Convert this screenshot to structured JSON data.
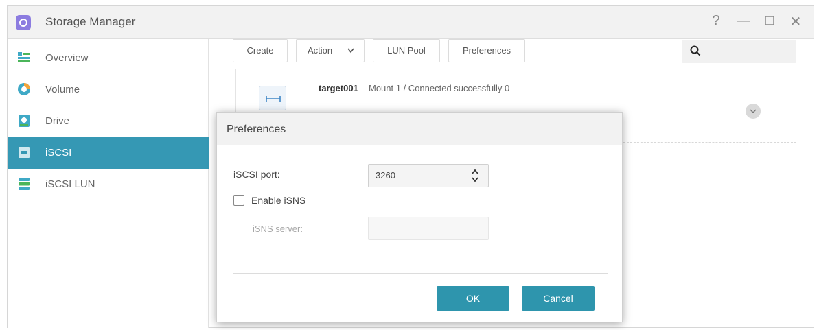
{
  "window": {
    "title": "Storage Manager",
    "controls": [
      "?",
      "—",
      "□",
      "✕"
    ]
  },
  "sidebar": {
    "items": [
      {
        "label": "Overview",
        "icon": "overview-icon"
      },
      {
        "label": "Volume",
        "icon": "volume-icon"
      },
      {
        "label": "Drive",
        "icon": "drive-icon"
      },
      {
        "label": "iSCSI",
        "icon": "iscsi-icon",
        "active": true
      },
      {
        "label": "iSCSI LUN",
        "icon": "iscsi-lun-icon"
      }
    ]
  },
  "toolbar": {
    "create": "Create",
    "action": "Action",
    "lun_pool": "LUN Pool",
    "preferences": "Preferences"
  },
  "search": {
    "placeholder": ""
  },
  "target": {
    "name": "target001",
    "status": "Mount 1 / Connected successfully 0"
  },
  "dialog": {
    "title": "Preferences",
    "port_label": "iSCSI port:",
    "port_value": "3260",
    "enable_isns_label": "Enable iSNS",
    "enable_isns_checked": false,
    "isns_server_label": "iSNS server:",
    "isns_server_value": "",
    "ok": "OK",
    "cancel": "Cancel"
  },
  "colors": {
    "accent": "#3598b4",
    "button": "#2e95ad",
    "app_icon": "#8c7ce0"
  }
}
